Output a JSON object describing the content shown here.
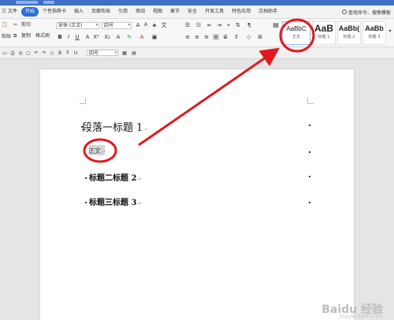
{
  "menu": {
    "items": [
      "三 文件",
      "开始",
      "个性指荐卡",
      "插入",
      "页面布局",
      "引用",
      "审阅",
      "视图",
      "章节",
      "安全",
      "开发工具",
      "特色应用",
      "文档助手"
    ],
    "active_index": 1,
    "search_label": "查找命令、搜索模板"
  },
  "ribbon": {
    "cut_label": "剪切",
    "paste_label": "粘贴",
    "copy_label": "复制",
    "format_painter_label": "格式刷",
    "font_name": "宋体 (正文)",
    "font_size": "四号",
    "style_samples": [
      {
        "sample": "AaBbC",
        "name": "正文"
      },
      {
        "sample": "AaB",
        "name": "标题 1"
      },
      {
        "sample": "AaBb(",
        "name": "标题 2"
      },
      {
        "sample": "AaBb",
        "name": "标题 3"
      }
    ]
  },
  "qat": {
    "size_value": "四号"
  },
  "document": {
    "heading1": "段落一标题 1",
    "body": "正文",
    "heading2": "标题二标题 2",
    "heading3": "标题三标题 3",
    "return_mark": "↵"
  },
  "watermark": {
    "main": "Baidu 经验",
    "sub": "jingyan.baidu.com"
  },
  "colors": {
    "accent": "#2a6edb",
    "annotation": "#e0191f"
  }
}
